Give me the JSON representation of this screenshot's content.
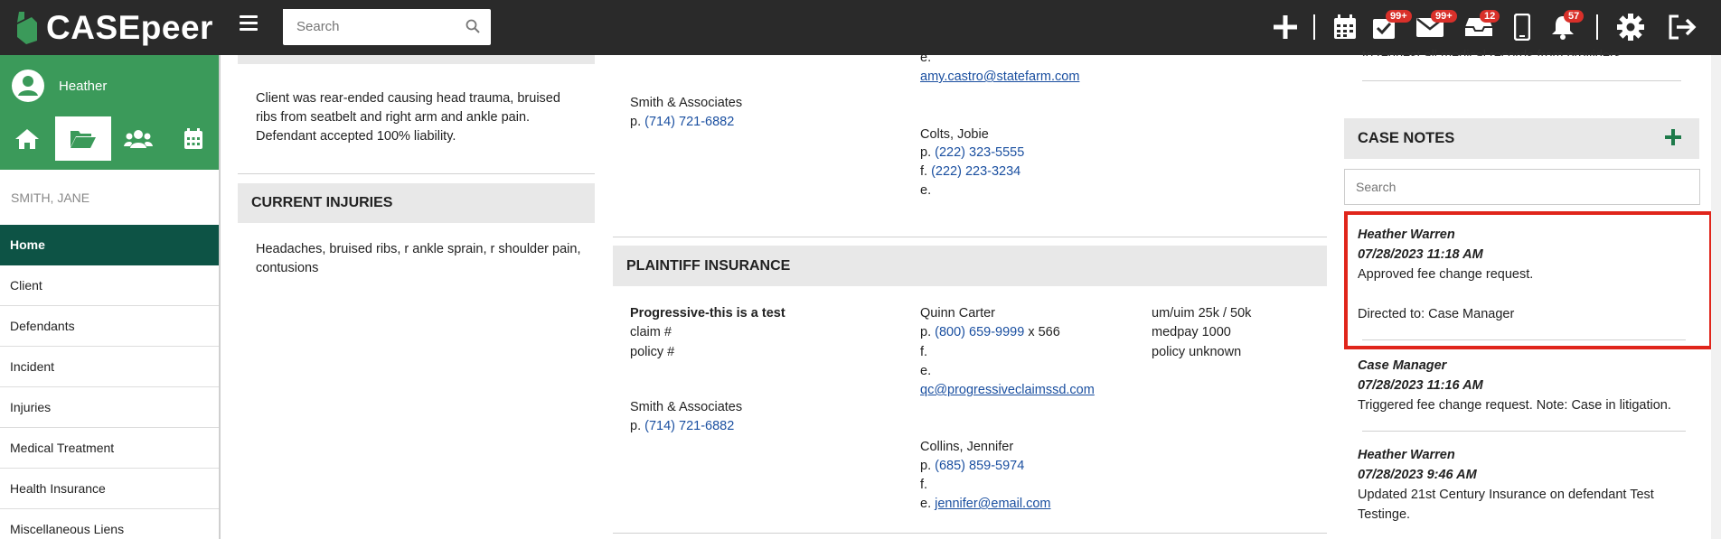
{
  "app": {
    "name": "CASEpeer"
  },
  "topbar": {
    "search_placeholder": "Search",
    "badges": {
      "tasks": "99+",
      "mail": "99+",
      "inbox": "12",
      "notifications": "57"
    }
  },
  "sidebar": {
    "user": "Heather",
    "client": "SMITH, JANE",
    "items": [
      {
        "label": "Home"
      },
      {
        "label": "Client"
      },
      {
        "label": "Defendants"
      },
      {
        "label": "Incident"
      },
      {
        "label": "Injuries"
      },
      {
        "label": "Medical Treatment"
      },
      {
        "label": "Health Insurance"
      },
      {
        "label": "Miscellaneous Liens"
      }
    ]
  },
  "incident": {
    "description": "Client was rear-ended causing head trauma, bruised ribs from seatbelt and right arm and ankle pain. Defendant accepted 100% liability."
  },
  "current_injuries": {
    "title": "CURRENT INJURIES",
    "text": "Headaches, bruised ribs, r ankle sprain, r shoulder pain, contusions"
  },
  "defendant_top": {
    "firm": "Smith & Associates",
    "firm_phone_prefix": "p.",
    "firm_phone": "(714) 721-6882",
    "email_prefix": "e.",
    "email": "amy.castro@statefarm.com",
    "contact2_name": "Colts, Jobie",
    "contact2_p_prefix": "p.",
    "contact2_phone": "(222) 323-5555",
    "contact2_f_prefix": "f.",
    "contact2_fax": "(222) 223-3234",
    "contact2_e_prefix": "e."
  },
  "plaintiff_insurance": {
    "title": "PLAINTIFF INSURANCE",
    "carrier": "Progressive-this is a test",
    "claim_label": "claim #",
    "policy_label": "policy #",
    "firm": "Smith & Associates",
    "firm_phone_prefix": "p.",
    "firm_phone": "(714) 721-6882",
    "adjuster1": {
      "name": "Quinn Carter",
      "p_prefix": "p.",
      "phone": "(800) 659-9999",
      "ext": " x 566",
      "f_prefix": "f.",
      "e_prefix": "e.",
      "email": "qc@progressiveclaimssd.com"
    },
    "adjuster2": {
      "name": "Collins, Jennifer",
      "p_prefix": "p.",
      "phone": "(685) 859-5974",
      "f_prefix": "f.",
      "e_prefix": "e.",
      "email": "jennifer@email.com"
    },
    "coverage": [
      "um/uim 25k / 50k",
      "medpay 1000",
      "policy unknown"
    ]
  },
  "case_notes": {
    "title": "CASE NOTES",
    "search_placeholder": "Search",
    "top_cut_text": "to request all medical records from providers",
    "notes": [
      {
        "author": "Heather Warren",
        "timestamp": "07/28/2023 11:18 AM",
        "text": "Approved fee change request.",
        "directed": "Directed to: Case Manager"
      },
      {
        "author": "Case Manager",
        "timestamp": "07/28/2023 11:16 AM",
        "text": "Triggered fee change request. Note: Case in litigation."
      },
      {
        "author": "Heather Warren",
        "timestamp": "07/28/2023 9:46 AM",
        "text": "Updated 21st Century Insurance on defendant Test Testinge."
      }
    ]
  }
}
